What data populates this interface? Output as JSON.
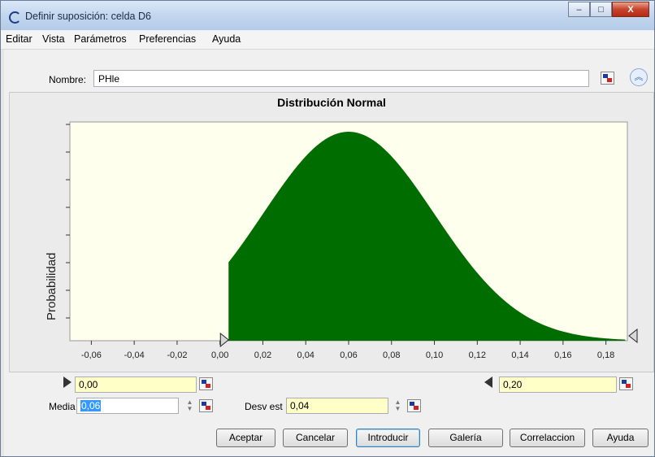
{
  "window": {
    "title": "Definir suposición: celda D6",
    "controls": [
      "–",
      "□",
      "X"
    ]
  },
  "menu": [
    "Editar",
    "Vista",
    "Parámetros",
    "Preferencias",
    "Ayuda"
  ],
  "name": {
    "label": "Nombre:",
    "value": "PHle"
  },
  "chart_data": {
    "type": "area",
    "title": "Distribución Normal",
    "ylabel": "Probabilidad",
    "xlabel": "",
    "x_ticks": [
      "-0,06",
      "-0,04",
      "-0,02",
      "0,00",
      "0,02",
      "0,04",
      "0,06",
      "0,08",
      "0,10",
      "0,12",
      "0,14",
      "0,16",
      "0,18"
    ],
    "xlim": [
      -0.07,
      0.19
    ],
    "distribution": {
      "name": "Normal",
      "mean": 0.06,
      "std_dev": 0.04
    },
    "shaded_range": [
      0.004,
      0.189
    ],
    "fill_color": "#006d00",
    "plot_background": "#ffffee",
    "grid": false
  },
  "range": {
    "lower": "0,00",
    "upper": "0,20"
  },
  "params": {
    "mean_label": "Media",
    "mean_value": "0,06",
    "std_label": "Desv est",
    "std_value": "0,04"
  },
  "buttons": [
    "Aceptar",
    "Cancelar",
    "Introducir",
    "Galería",
    "Correlaccion",
    "Ayuda"
  ]
}
